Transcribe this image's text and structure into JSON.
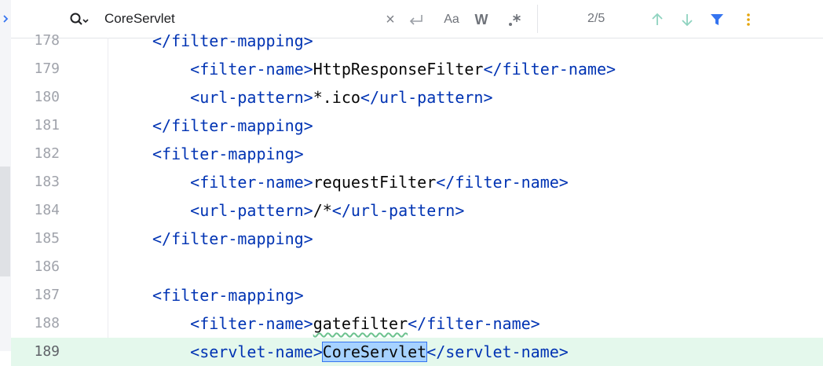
{
  "search": {
    "query": "CoreServlet",
    "match_count": "2/5",
    "words_label": "W",
    "case_label": "Aa"
  },
  "editor": {
    "lines": [
      {
        "num": "178",
        "indent": 1,
        "open": "</",
        "name": "filter-mapping",
        "close": ">",
        "text": "",
        "partial": true
      },
      {
        "num": "179",
        "indent": 2,
        "open": "<",
        "name": "filter-name",
        "close": ">",
        "text": "HttpResponseFilter",
        "end_name": "filter-name"
      },
      {
        "num": "180",
        "indent": 2,
        "open": "<",
        "name": "url-pattern",
        "close": ">",
        "text": "*.ico",
        "end_name": "url-pattern"
      },
      {
        "num": "181",
        "indent": 1,
        "open": "</",
        "name": "filter-mapping",
        "close": ">",
        "text": ""
      },
      {
        "num": "182",
        "indent": 1,
        "open": "<",
        "name": "filter-mapping",
        "close": ">",
        "text": ""
      },
      {
        "num": "183",
        "indent": 2,
        "open": "<",
        "name": "filter-name",
        "close": ">",
        "text": "requestFilter",
        "end_name": "filter-name"
      },
      {
        "num": "184",
        "indent": 2,
        "open": "<",
        "name": "url-pattern",
        "close": ">",
        "text": "/*",
        "end_name": "url-pattern"
      },
      {
        "num": "185",
        "indent": 1,
        "open": "</",
        "name": "filter-mapping",
        "close": ">",
        "text": ""
      },
      {
        "num": "186",
        "indent": 0,
        "open": "",
        "name": "",
        "close": "",
        "text": ""
      },
      {
        "num": "187",
        "indent": 1,
        "open": "<",
        "name": "filter-mapping",
        "close": ">",
        "text": ""
      },
      {
        "num": "188",
        "indent": 2,
        "open": "<",
        "name": "filter-name",
        "close": ">",
        "text": "gatefilter",
        "end_name": "filter-name",
        "wavy": true
      },
      {
        "num": "189",
        "indent": 2,
        "open": "<",
        "name": "servlet-name",
        "close": ">",
        "text": "CoreServlet",
        "end_name": "servlet-name",
        "highlight": true,
        "current": true
      }
    ]
  },
  "colors": {
    "tag": "#0033b3",
    "text": "#080808",
    "line_number": "#a0a3ab",
    "current_line": "#e4f8ec",
    "match_highlight": "#a6d2ff",
    "filter_icon": "#3574f0",
    "more_icon": "#e5a50a"
  }
}
